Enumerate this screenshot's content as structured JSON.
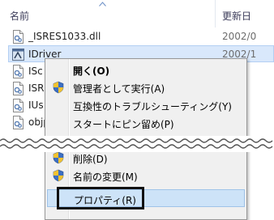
{
  "columns": {
    "name": "名前",
    "date": "更新日"
  },
  "files": [
    {
      "name": "_ISRES1033.dll",
      "date": "2002/0",
      "icon": "dll-file-icon"
    },
    {
      "name": "IDriver",
      "date": "2002/1",
      "icon": "exe-app-icon",
      "selected": true
    },
    {
      "name": "ISc",
      "date": "",
      "icon": "dll-file-icon"
    },
    {
      "name": "ISR",
      "date": "",
      "icon": "dll-file-icon"
    },
    {
      "name": "IUs",
      "date": "",
      "icon": "dll-file-icon"
    },
    {
      "name": "objp",
      "date": "",
      "icon": "dll-file-icon"
    }
  ],
  "context_menu": {
    "items": [
      {
        "label": "開く(O)",
        "bold": true,
        "icon": null
      },
      {
        "label": "管理者として実行(A)",
        "icon": "uac-shield-icon"
      },
      {
        "label": "互換性のトラブルシューティング(Y)",
        "icon": null
      },
      {
        "label": "スタートにピン留め(P)",
        "icon": null
      },
      {
        "label": "削除(D)",
        "icon": "uac-shield-icon"
      },
      {
        "label": "名前の変更(M)",
        "icon": "uac-shield-icon"
      },
      {
        "label": "プロパティ(R)",
        "icon": null,
        "highlighted": true
      }
    ]
  },
  "colors": {
    "selection": "#d9e8fb",
    "menu_bg": "#f0f0f0",
    "menu_highlight": "#cde3f8",
    "annotation_box": "#111111"
  }
}
